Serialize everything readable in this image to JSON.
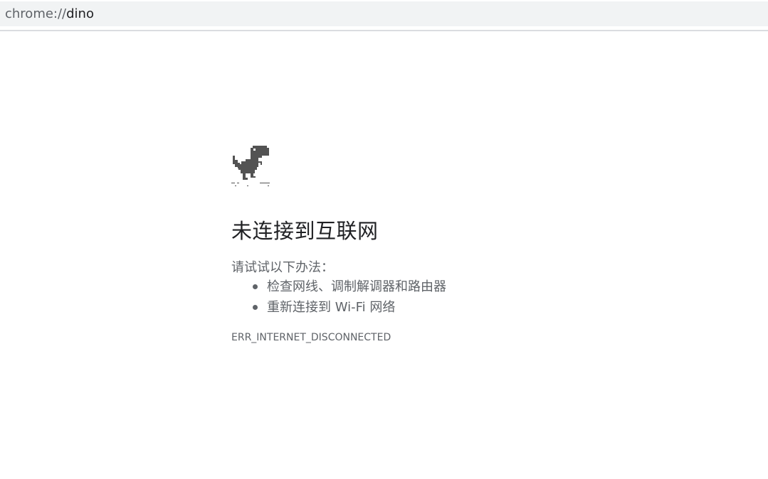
{
  "address_bar": {
    "scheme": "chrome://",
    "host": "dino"
  },
  "error_page": {
    "icon": "offline-dinosaur-icon",
    "headline": "未连接到互联网",
    "suggestions_intro": "请试试以下办法：",
    "suggestions": [
      "检查网线、调制解调器和路由器",
      "重新连接到 Wi-Fi 网络"
    ],
    "error_code": "ERR_INTERNET_DISCONNECTED"
  },
  "colors": {
    "address_bar_bg": "#f1f3f4",
    "text_primary": "#202124",
    "text_secondary": "#5f6368",
    "dino": "#535353"
  }
}
